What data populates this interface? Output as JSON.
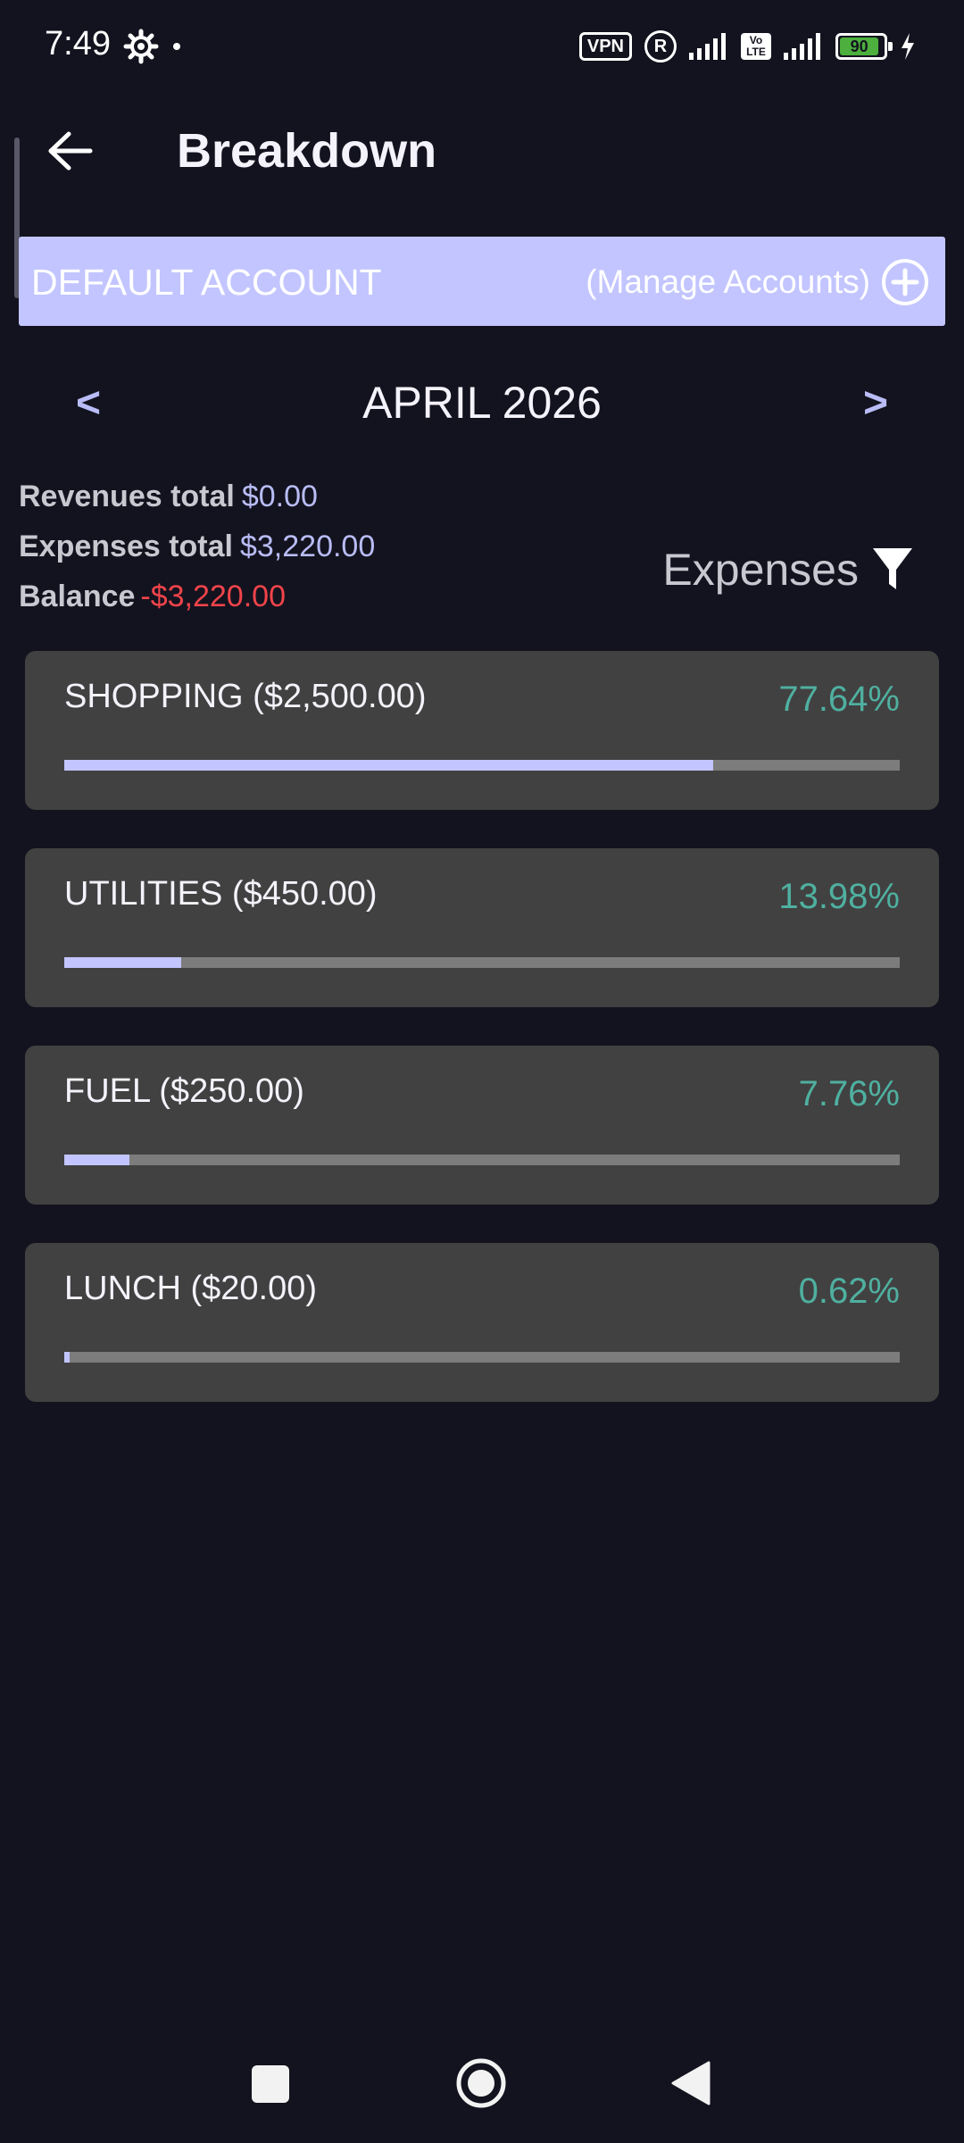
{
  "status_bar": {
    "time": "7:49",
    "vpn_label": "VPN",
    "registered_label": "R",
    "lte_label_top": "Vo",
    "lte_label_bottom": "LTE",
    "battery_level": "90",
    "battery_fraction": 0.9
  },
  "app_bar": {
    "title": "Breakdown",
    "back_icon": "arrow-left-icon"
  },
  "account": {
    "name": "DEFAULT ACCOUNT",
    "manage_label": "(Manage Accounts)",
    "add_icon": "plus-circle-icon"
  },
  "month": {
    "prev_label": "<",
    "current": "APRIL 2026",
    "next_label": ">"
  },
  "totals": {
    "revenues_label": "Revenues total",
    "revenues_value": "$0.00",
    "expenses_label": "Expenses total",
    "expenses_value": "$3,220.00",
    "balance_label": "Balance",
    "balance_value": "-$3,220.00"
  },
  "filter": {
    "label": "Expenses",
    "icon": "filter-funnel-icon"
  },
  "categories": [
    {
      "name": "SHOPPING ($2,500.00)",
      "percent": "77.64%",
      "fraction": 0.7764
    },
    {
      "name": "UTILITIES ($450.00)",
      "percent": "13.98%",
      "fraction": 0.1398
    },
    {
      "name": "FUEL ($250.00)",
      "percent": "7.76%",
      "fraction": 0.0776
    },
    {
      "name": "LUNCH ($20.00)",
      "percent": "0.62%",
      "fraction": 0.0062
    }
  ],
  "colors": {
    "background": "#13131f",
    "accent": "#c2c5ff",
    "card": "#414141",
    "percent_text": "#4fb0a0",
    "negative": "#f0444a",
    "battery": "#4caf3e"
  },
  "nav_bar": {
    "recent_icon": "square-recent-apps-icon",
    "home_icon": "circle-home-icon",
    "back_icon": "triangle-back-icon"
  }
}
